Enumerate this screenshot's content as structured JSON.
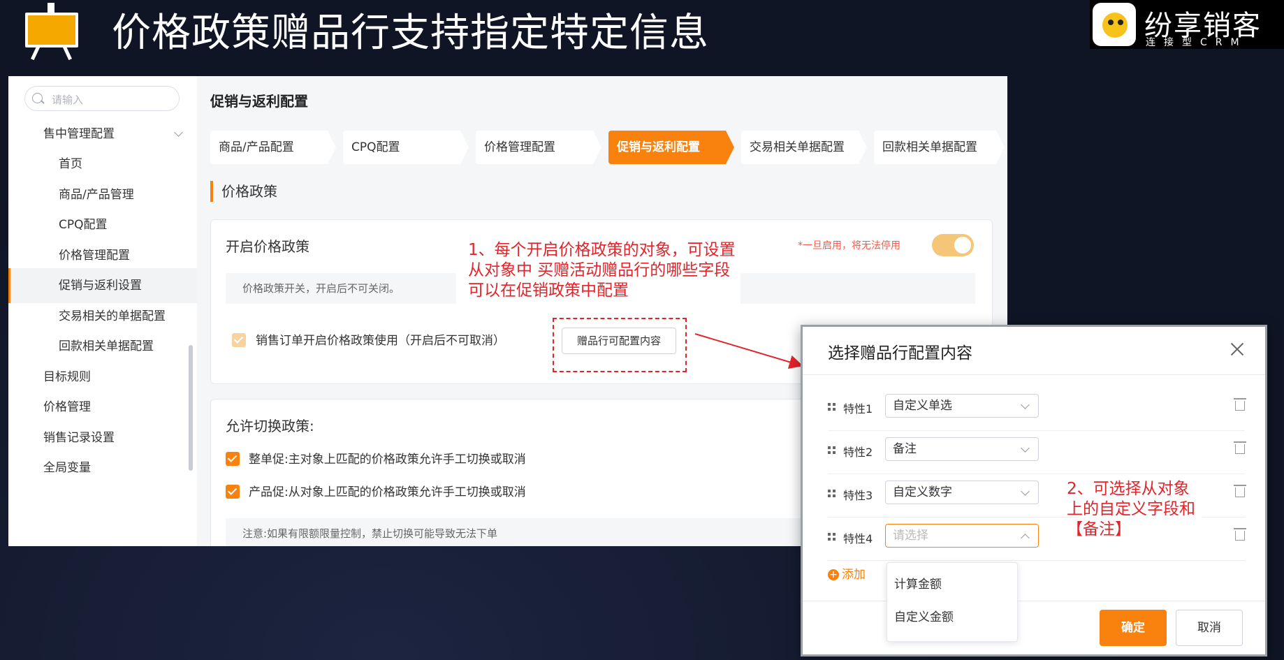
{
  "slide": {
    "title": "价格政策赠品行支持指定特定信息"
  },
  "logo": {
    "brand": "纷享销客",
    "sub": "连接型CRM"
  },
  "sidebar": {
    "search_placeholder": "请输入",
    "items": [
      {
        "label": "售中管理配置",
        "level": 1,
        "expanded": true
      },
      {
        "label": "首页",
        "level": 2
      },
      {
        "label": "商品/产品管理",
        "level": 2
      },
      {
        "label": "CPQ配置",
        "level": 2
      },
      {
        "label": "价格管理配置",
        "level": 2
      },
      {
        "label": "促销与返利设置",
        "level": 2,
        "active": true
      },
      {
        "label": "交易相关的单据配置",
        "level": 2
      },
      {
        "label": "回款相关单据配置",
        "level": 2
      },
      {
        "label": "目标规则",
        "level": 1
      },
      {
        "label": "价格管理",
        "level": 1
      },
      {
        "label": "销售记录设置",
        "level": 1
      },
      {
        "label": "全局变量",
        "level": 1
      }
    ]
  },
  "main": {
    "title": "促销与返利配置",
    "tabs": [
      {
        "label": "商品/产品配置"
      },
      {
        "label": "CPQ配置"
      },
      {
        "label": "价格管理配置"
      },
      {
        "label": "促销与返利配置",
        "active": true
      },
      {
        "label": "交易相关单据配置"
      },
      {
        "label": "回款相关单据配置"
      }
    ],
    "section_title": "价格政策",
    "card1": {
      "title": "开启价格政策",
      "warning": "*一旦启用，将无法停用",
      "toggle_on": true,
      "desc": "价格政策开关，开启后不可关闭。",
      "checkbox_label": "销售订单开启价格政策使用（开启后不可取消）",
      "gift_button": "赠品行可配置内容"
    },
    "card2": {
      "title": "允许切换政策:",
      "options": [
        "整单促:主对象上匹配的价格政策允许手工切换或取消",
        "产品促:从对象上匹配的价格政策允许手工切换或取消"
      ],
      "note": "注意:如果有限额限量控制，禁止切换可能导致无法下单"
    }
  },
  "annotations": {
    "note1": "1、每个开启价格政策的对象，可设置从对象中 买赠活动赠品行的哪些字段可以在促销政策中配置",
    "note2": "2、可选择从对象上的自定义字段和【备注】"
  },
  "modal": {
    "title": "选择赠品行配置内容",
    "rows": [
      {
        "label": "特性1",
        "value": "自定义单选"
      },
      {
        "label": "特性2",
        "value": "备注"
      },
      {
        "label": "特性3",
        "value": "自定义数字"
      },
      {
        "label": "特性4",
        "placeholder": "请选择"
      }
    ],
    "add_label": "添加",
    "dropdown_options": [
      "计算金额",
      "自定义金额"
    ],
    "ok_label": "确定",
    "cancel_label": "取消"
  },
  "colors": {
    "accent": "#f9820f",
    "annotation": "#e3242b"
  }
}
